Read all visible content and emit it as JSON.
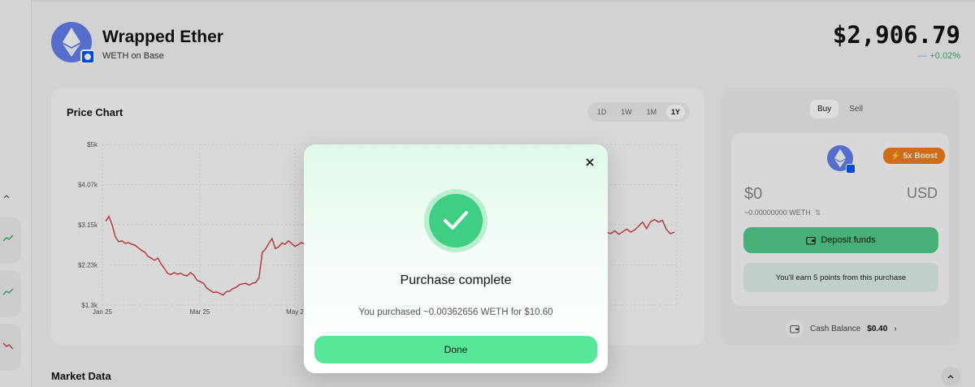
{
  "token": {
    "name": "Wrapped Ether",
    "network_label": "WETH on Base",
    "price": "$2,906.79",
    "change": "+0.02%"
  },
  "chart": {
    "title": "Price Chart",
    "ranges": [
      "1D",
      "1W",
      "1M",
      "1Y"
    ],
    "active_range": "1Y",
    "line_color": "#d33a3a"
  },
  "chart_data": {
    "type": "line",
    "y_ticks": [
      "$5k",
      "$4.07k",
      "$3.15k",
      "$2.23k",
      "$1.3k"
    ],
    "x_ticks": [
      "Jan 25",
      "Mar 25",
      "May 2"
    ],
    "ylim": [
      1300,
      5000
    ],
    "grid": true,
    "series": [
      {
        "values": [
          3230,
          3340,
          3150,
          2870,
          2760,
          2780,
          2720,
          2740,
          2700,
          2680,
          2620,
          2560,
          2520,
          2420,
          2380,
          2330,
          2380,
          2250,
          2140,
          2030,
          2000,
          2050,
          2010,
          2030,
          1990,
          1970,
          2050,
          1990,
          1870,
          1840,
          1800,
          1690,
          1640,
          1590,
          1600,
          1570,
          1530,
          1610,
          1620,
          1680,
          1710,
          1770,
          1790,
          1800,
          1760,
          1800,
          1820,
          1930,
          2510,
          2590,
          2720,
          2830,
          2600,
          2640,
          2730,
          2700,
          2780,
          2720,
          2650,
          2690,
          2740,
          2700
        ],
        "values_right": [
          2970,
          2950,
          3010,
          2930,
          2990,
          3050,
          2980,
          3030,
          3120,
          3210,
          3060,
          3220,
          3270,
          3210,
          3250,
          3040,
          2940,
          2980
        ]
      }
    ]
  },
  "trade": {
    "tabs": [
      "Buy",
      "Sell"
    ],
    "active_tab": "Buy",
    "boost_label": "5x Boost",
    "amount": "$0",
    "currency": "USD",
    "weth_estimate": "~0.00000000 WETH",
    "deposit_label": "Deposit funds",
    "points_text": "You'll earn 5 points from this purchase",
    "cash_label": "Cash Balance",
    "cash_value": "$0.40"
  },
  "market": {
    "title": "Market Data"
  },
  "modal": {
    "title": "Purchase complete",
    "description": "You purchased ~0.00362656 WETH for $10.60",
    "done_label": "Done"
  },
  "colors": {
    "accent_green": "#3fcf82",
    "eth_blue": "#627eea",
    "base_blue": "#0052ff",
    "boost_orange": "#f07d1a"
  }
}
